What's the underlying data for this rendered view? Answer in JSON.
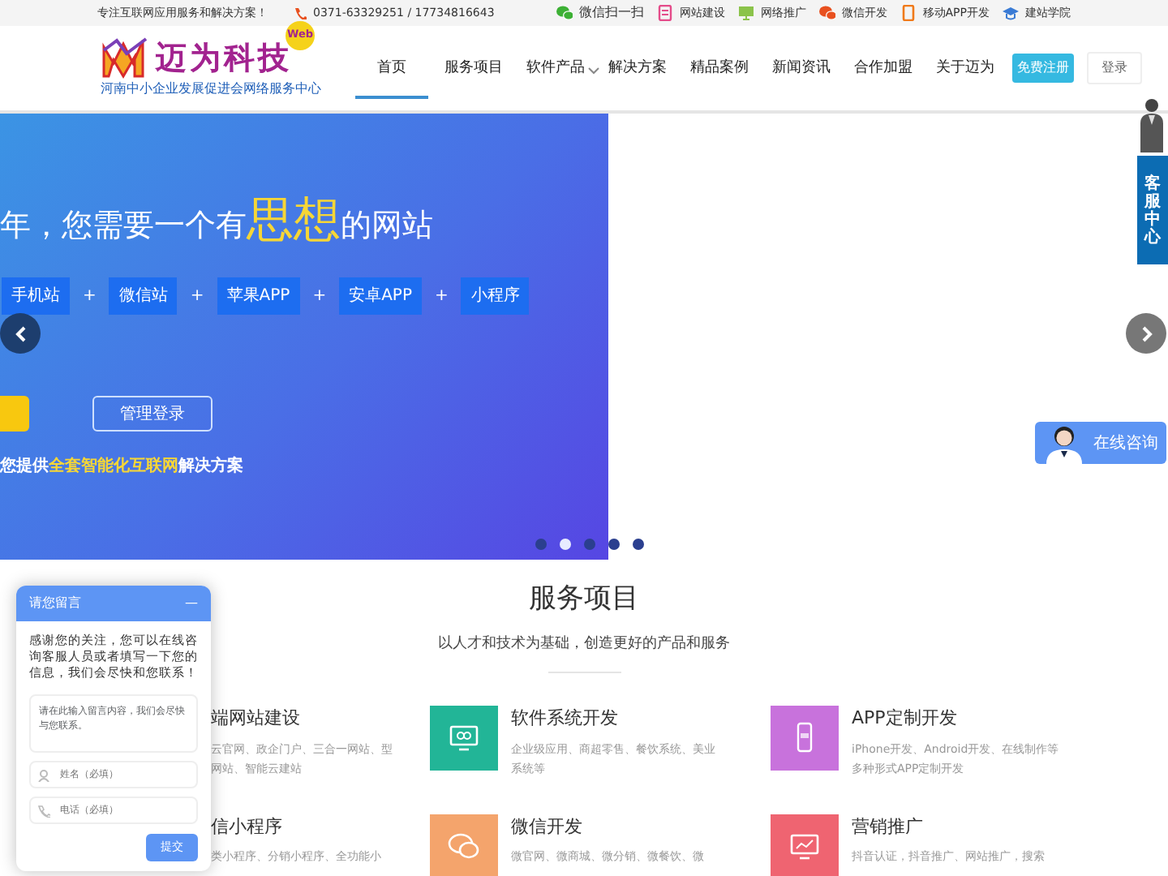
{
  "top_bar": {
    "slogan": "专注互联网应用服务和解决方案！",
    "phone": "0371-63329251 / 17734816643",
    "links": [
      {
        "label": "微信扫一扫",
        "kind": "wechat"
      },
      {
        "label": "网站建设",
        "kind": "site"
      },
      {
        "label": "网络推广",
        "kind": "monitor"
      },
      {
        "label": "微信开发",
        "kind": "chat"
      },
      {
        "label": "移动APP开发",
        "kind": "phone"
      },
      {
        "label": "建站学院",
        "kind": "school"
      }
    ]
  },
  "header": {
    "brand": "迈为科技",
    "badge": "Web",
    "slogan": "河南中小企业发展促进会网络服务中心",
    "nav": [
      {
        "label": "首页",
        "selected": true,
        "dropdown": false
      },
      {
        "label": "服务项目",
        "selected": false,
        "dropdown": false
      },
      {
        "label": "软件产品",
        "selected": false,
        "dropdown": true
      },
      {
        "label": "解决方案",
        "selected": false,
        "dropdown": false
      },
      {
        "label": "精品案例",
        "selected": false,
        "dropdown": false
      },
      {
        "label": "新闻资讯",
        "selected": false,
        "dropdown": false
      },
      {
        "label": "合作加盟",
        "selected": false,
        "dropdown": false
      },
      {
        "label": "关于迈为",
        "selected": false,
        "dropdown": false
      }
    ],
    "register": "免费注册",
    "login": "登录"
  },
  "hero": {
    "headline": {
      "before": "年，您需要一个有",
      "highlight": "思想",
      "after": "的网站"
    },
    "tags": [
      "手机站",
      "微信站",
      "苹果APP",
      "安卓APP",
      "小程序"
    ],
    "joiner": "+",
    "admin_button": "管理登录",
    "tagline": {
      "before": "您提供",
      "highlight": "全套智能化互联网",
      "after": "解决方案"
    },
    "dots": [
      {
        "selected": false
      },
      {
        "selected": true
      },
      {
        "selected": false
      },
      {
        "selected": false
      },
      {
        "selected": false
      }
    ]
  },
  "side": {
    "service_tab": "客服中心",
    "consult_button": "在线咨询"
  },
  "services": {
    "title": "服务项目",
    "subtitle": "以人才和技术为基础，创造更好的产品和服务",
    "items": [
      {
        "title": "端网站建设",
        "desc": "云官网、政企门户、三合一网站、型网站、智能云建站",
        "kind": "hidden"
      },
      {
        "title": "软件系统开发",
        "desc": "企业级应用、商超零售、餐饮系统、美业系统等",
        "color": "#22b597",
        "kind": "monitor"
      },
      {
        "title": "APP定制开发",
        "desc": "iPhone开发、Android开发、在线制作等多种形式APP定制开发",
        "color": "#c872dc",
        "kind": "phone"
      },
      {
        "title": "信小程序",
        "desc": "类小程序、分销小程序、全功能小",
        "kind": "hidden"
      },
      {
        "title": "微信开发",
        "desc": "微官网、微商城、微分销、微餐饮、微",
        "color": "#f4a46c",
        "kind": "chat"
      },
      {
        "title": "营销推广",
        "desc": "抖音认证，抖音推广、网站推广，搜索",
        "color": "#ef6471",
        "kind": "chart"
      }
    ]
  },
  "chat_widget": {
    "title": "请您留言",
    "minimize": "—",
    "intro": "感谢您的关注，您可以在线咨询客服人员或者填写一下您的信息，我们会尽快和您联系！",
    "message_placeholder": "请在此输入留言内容，我们会尽快与您联系。",
    "name_placeholder": "姓名（必填）",
    "phone_placeholder": "电话（必填）",
    "submit": "提交"
  }
}
